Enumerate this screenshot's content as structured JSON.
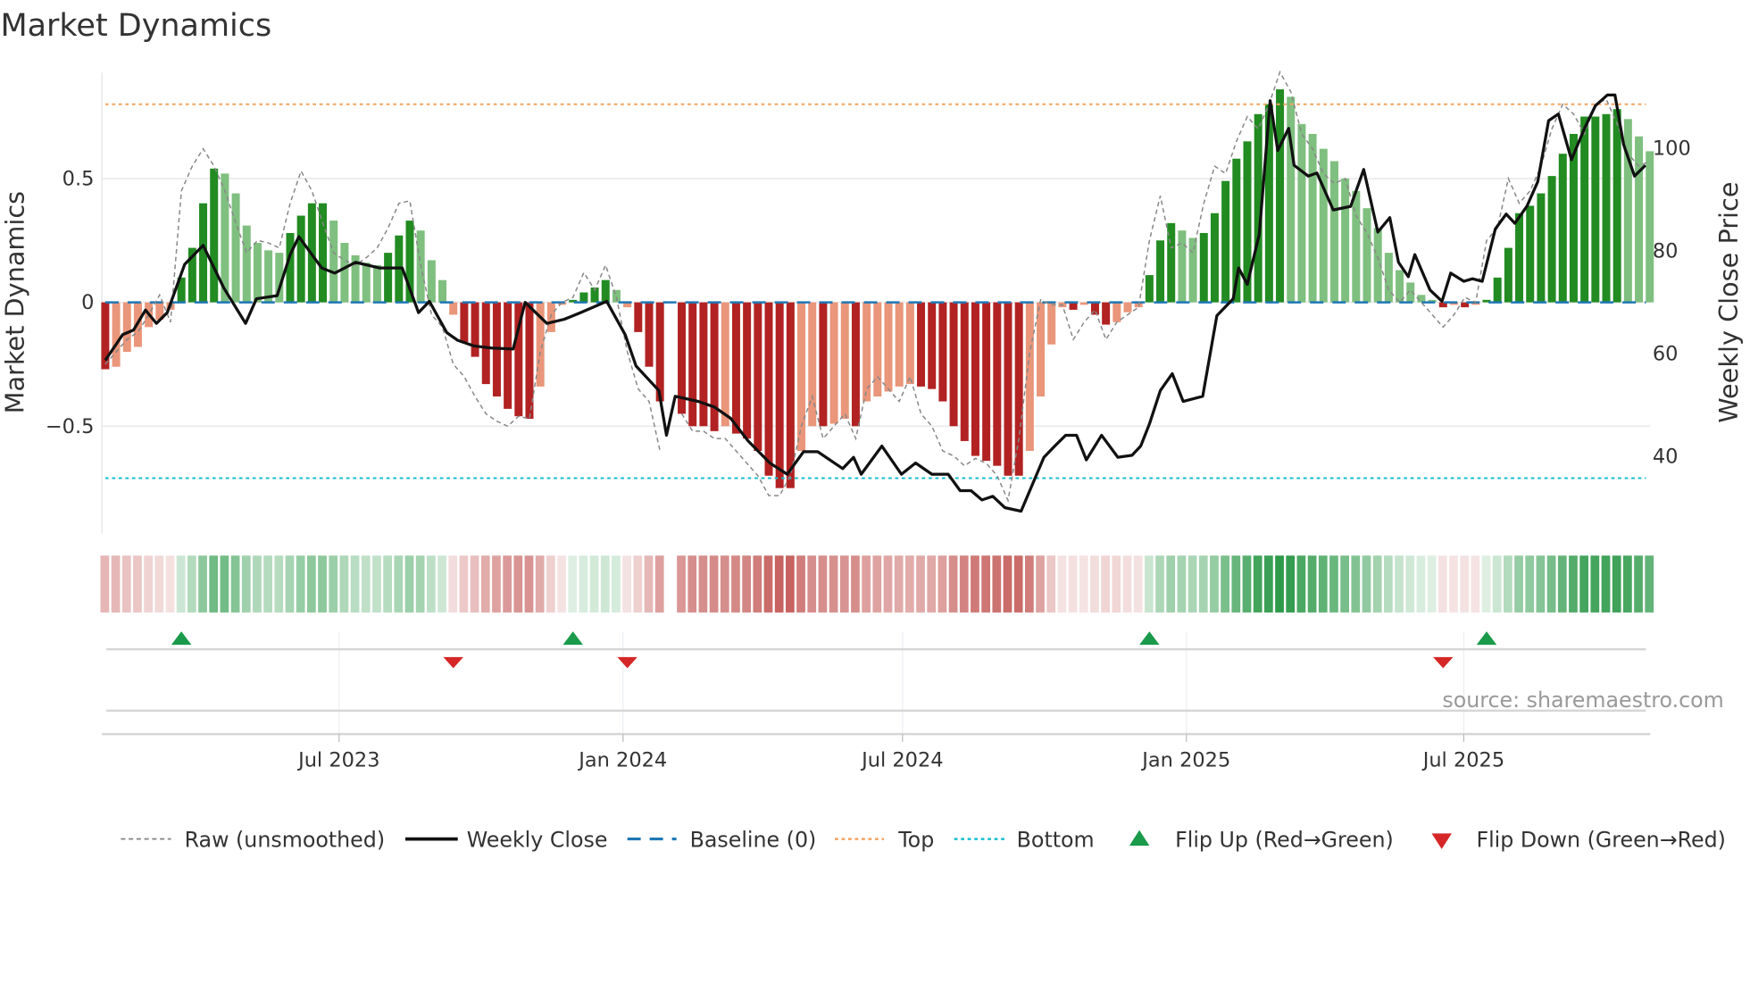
{
  "chart_data": {
    "type": "bar",
    "title": "Market Dynamics",
    "ylabel_left": "Market Dynamics",
    "ylabel_right": "Weekly Close Price",
    "left_yticks": [
      {
        "v": 0.5,
        "label": "0.5"
      },
      {
        "v": 0,
        "label": "0"
      },
      {
        "v": -0.5,
        "label": "−0.5"
      }
    ],
    "right_yticks": [
      {
        "v": 100,
        "label": "100"
      },
      {
        "v": 80,
        "label": "80"
      },
      {
        "v": 60,
        "label": "60"
      },
      {
        "v": 40,
        "label": "40"
      }
    ],
    "x_unit": "week index",
    "xticks": [
      {
        "week": 21.5,
        "label": "Jul 2023"
      },
      {
        "week": 47.6,
        "label": "Jan 2024"
      },
      {
        "week": 73.3,
        "label": "Jul 2024"
      },
      {
        "week": 99.4,
        "label": "Jan 2025"
      },
      {
        "week": 124.9,
        "label": "Jul 2025"
      }
    ],
    "top_level": 0.8,
    "bottom_level": -0.71,
    "baseline": 0,
    "dynamics": [
      -0.27,
      -0.26,
      -0.2,
      -0.18,
      -0.1,
      -0.07,
      -0.03,
      0.1,
      0.22,
      0.4,
      0.54,
      0.52,
      0.44,
      0.31,
      0.24,
      0.21,
      0.2,
      0.28,
      0.35,
      0.4,
      0.4,
      0.33,
      0.24,
      0.19,
      0.16,
      0.15,
      0.2,
      0.27,
      0.33,
      0.29,
      0.17,
      0.09,
      -0.05,
      -0.16,
      -0.22,
      -0.33,
      -0.38,
      -0.43,
      -0.46,
      -0.47,
      -0.34,
      -0.12,
      -0.01,
      0.01,
      0.04,
      0.06,
      0.09,
      0.05,
      -0.02,
      -0.12,
      -0.26,
      -0.4,
      null,
      -0.45,
      -0.5,
      -0.5,
      -0.52,
      -0.5,
      -0.53,
      -0.55,
      -0.6,
      -0.7,
      -0.75,
      -0.75,
      -0.6,
      -0.5,
      -0.5,
      -0.49,
      -0.47,
      -0.5,
      -0.4,
      -0.38,
      -0.36,
      -0.34,
      -0.33,
      -0.34,
      -0.35,
      -0.4,
      -0.5,
      -0.56,
      -0.62,
      -0.64,
      -0.66,
      -0.7,
      -0.7,
      -0.6,
      -0.38,
      -0.17,
      -0.02,
      -0.03,
      -0.01,
      -0.05,
      -0.09,
      -0.08,
      -0.04,
      -0.02,
      0.11,
      0.25,
      0.32,
      0.29,
      0.26,
      0.28,
      0.36,
      0.49,
      0.58,
      0.65,
      0.76,
      0.8,
      0.86,
      0.83,
      0.72,
      0.68,
      0.62,
      0.57,
      0.5,
      0.45,
      0.38,
      0.3,
      0.2,
      0.13,
      0.08,
      0.03,
      0.01,
      -0.02,
      -0.01,
      -0.02,
      -0.01,
      0.01,
      0.1,
      0.22,
      0.36,
      0.39,
      0.44,
      0.51,
      0.6,
      0.68,
      0.75,
      0.75,
      0.76,
      0.78,
      0.74,
      0.67,
      0.61
    ],
    "raw": [
      -0.25,
      -0.2,
      -0.15,
      -0.12,
      -0.05,
      0.03,
      -0.08,
      0.45,
      0.55,
      0.62,
      0.55,
      0.45,
      0.32,
      0.2,
      0.25,
      0.24,
      0.22,
      0.4,
      0.53,
      0.45,
      0.32,
      0.2,
      0.17,
      0.15,
      0.18,
      0.22,
      0.3,
      0.4,
      0.41,
      0.15,
      -0.05,
      -0.1,
      -0.25,
      -0.3,
      -0.38,
      -0.45,
      -0.48,
      -0.5,
      -0.46,
      -0.47,
      -0.2,
      -0.05,
      0.0,
      0.02,
      0.12,
      0.05,
      0.15,
      0.02,
      -0.2,
      -0.35,
      -0.4,
      -0.6,
      null,
      -0.45,
      -0.52,
      -0.52,
      -0.55,
      -0.55,
      -0.6,
      -0.65,
      -0.7,
      -0.78,
      -0.78,
      -0.7,
      -0.5,
      -0.38,
      -0.55,
      -0.5,
      -0.45,
      -0.55,
      -0.35,
      -0.3,
      -0.35,
      -0.4,
      -0.3,
      -0.45,
      -0.5,
      -0.6,
      -0.62,
      -0.66,
      -0.63,
      -0.65,
      -0.7,
      -0.8,
      -0.55,
      -0.2,
      0.01,
      -0.01,
      -0.01,
      -0.15,
      -0.08,
      -0.03,
      -0.15,
      -0.08,
      -0.05,
      -0.02,
      0.25,
      0.43,
      0.22,
      0.24,
      0.2,
      0.4,
      0.55,
      0.52,
      0.65,
      0.75,
      0.7,
      0.8,
      0.93,
      0.85,
      0.68,
      0.62,
      0.52,
      0.48,
      0.5,
      0.35,
      0.28,
      0.18,
      0.05,
      0.0,
      0.05,
      0.0,
      -0.05,
      -0.1,
      -0.05,
      0.02,
      0.0,
      0.25,
      0.3,
      0.5,
      0.4,
      0.45,
      0.55,
      0.7,
      0.8,
      0.76,
      0.68,
      0.8,
      0.82,
      0.72,
      0.6,
      0.55,
      0.57
    ],
    "weekly_close": [
      [
        0,
        58.7
      ],
      [
        1.6,
        63.7
      ],
      [
        2.6,
        64.6
      ],
      [
        3.7,
        68.5
      ],
      [
        4.7,
        65.9
      ],
      [
        5.7,
        68.0
      ],
      [
        7.3,
        77.4
      ],
      [
        9,
        81.1
      ],
      [
        10.9,
        72.8
      ],
      [
        12.9,
        65.9
      ],
      [
        13.9,
        70.7
      ],
      [
        15.8,
        71.3
      ],
      [
        17,
        79.3
      ],
      [
        17.8,
        82.8
      ],
      [
        19.9,
        76.7
      ],
      [
        21.1,
        75.7
      ],
      [
        23,
        77.8
      ],
      [
        25.2,
        76.7
      ],
      [
        27.3,
        76.7
      ],
      [
        28.8,
        68.0
      ],
      [
        29.8,
        70.2
      ],
      [
        31.4,
        64.1
      ],
      [
        32.4,
        62.6
      ],
      [
        33.9,
        61.5
      ],
      [
        35.5,
        61.1
      ],
      [
        37.5,
        60.9
      ],
      [
        38.6,
        70.0
      ],
      [
        40.6,
        65.9
      ],
      [
        42.2,
        66.7
      ],
      [
        43.7,
        68.0
      ],
      [
        46.1,
        70.2
      ],
      [
        47.8,
        63.7
      ],
      [
        48.8,
        57.6
      ],
      [
        50.9,
        52.8
      ],
      [
        51.6,
        44.1
      ],
      [
        52.4,
        51.7
      ],
      [
        54.5,
        50.7
      ],
      [
        56,
        49.6
      ],
      [
        57.5,
        47.4
      ],
      [
        59.1,
        43.0
      ],
      [
        61.1,
        38.7
      ],
      [
        62.7,
        36.5
      ],
      [
        64.2,
        40.9
      ],
      [
        65.5,
        40.9
      ],
      [
        67.8,
        37.6
      ],
      [
        68.8,
        39.8
      ],
      [
        69.5,
        36.5
      ],
      [
        71.4,
        42.0
      ],
      [
        73.2,
        36.5
      ],
      [
        74.5,
        38.7
      ],
      [
        76,
        36.5
      ],
      [
        77.5,
        36.5
      ],
      [
        78.6,
        33.3
      ],
      [
        79.6,
        33.3
      ],
      [
        80.6,
        31.5
      ],
      [
        81.6,
        32.2
      ],
      [
        82.7,
        30.0
      ],
      [
        84.2,
        29.3
      ],
      [
        85.2,
        34.3
      ],
      [
        86.3,
        39.8
      ],
      [
        87.3,
        42.0
      ],
      [
        88.3,
        44.1
      ],
      [
        89.3,
        44.1
      ],
      [
        90.2,
        39.3
      ],
      [
        91.6,
        44.1
      ],
      [
        93.1,
        39.8
      ],
      [
        94.4,
        40.2
      ],
      [
        95.2,
        42.0
      ],
      [
        96,
        46.3
      ],
      [
        97,
        52.8
      ],
      [
        98.1,
        56.1
      ],
      [
        99.1,
        50.7
      ],
      [
        100.9,
        51.7
      ],
      [
        102.2,
        67.4
      ],
      [
        103.7,
        70.7
      ],
      [
        104.2,
        76.7
      ],
      [
        105,
        73.5
      ],
      [
        106.1,
        83.3
      ],
      [
        107.1,
        109.3
      ],
      [
        107.8,
        99.6
      ],
      [
        108.8,
        103.9
      ],
      [
        109.3,
        96.7
      ],
      [
        110.6,
        94.6
      ],
      [
        111.4,
        95.2
      ],
      [
        112.9,
        88.0
      ],
      [
        114.5,
        88.7
      ],
      [
        115.7,
        95.9
      ],
      [
        117,
        83.7
      ],
      [
        118.1,
        86.5
      ],
      [
        118.9,
        77.8
      ],
      [
        119.8,
        75.0
      ],
      [
        120.4,
        79.3
      ],
      [
        121.8,
        72.4
      ],
      [
        122.9,
        70.2
      ],
      [
        123.7,
        75.7
      ],
      [
        124.9,
        74.1
      ],
      [
        125.7,
        74.6
      ],
      [
        126.6,
        74.1
      ],
      [
        127.8,
        84.3
      ],
      [
        128.8,
        87.2
      ],
      [
        129.6,
        85.4
      ],
      [
        130.7,
        88.7
      ],
      [
        131.7,
        93.5
      ],
      [
        132.7,
        105.4
      ],
      [
        133.6,
        106.7
      ],
      [
        134.8,
        97.8
      ],
      [
        136,
        103.9
      ],
      [
        137,
        108.3
      ],
      [
        138.1,
        110.4
      ],
      [
        138.8,
        110.4
      ],
      [
        139.6,
        100.7
      ],
      [
        140.6,
        94.6
      ],
      [
        141.6,
        96.7
      ]
    ],
    "flip_up_weeks": [
      7,
      43,
      96,
      127
    ],
    "flip_down_weeks": [
      32,
      48,
      123
    ],
    "colors": {
      "strong_green": "#228b22",
      "weak_green": "#7fbf7f",
      "strong_red": "#b22222",
      "weak_red": "#e9967a",
      "close": "#111111",
      "raw": "#888888",
      "baseline": "#1f77b4",
      "top": "#f4a460",
      "bottom": "#17becf",
      "flip_up": "#1a9a4a",
      "flip_down": "#d62728"
    },
    "legend": {
      "raw": "Raw (unsmoothed)",
      "close": "Weekly Close",
      "baseline": "Baseline (0)",
      "top": "Top",
      "bottom": "Bottom",
      "flip_up": "Flip Up (Red→Green)",
      "flip_down": "Flip Down (Green→Red)"
    },
    "legend_placement": "bottom",
    "source": "source: sharemaestro.com"
  }
}
